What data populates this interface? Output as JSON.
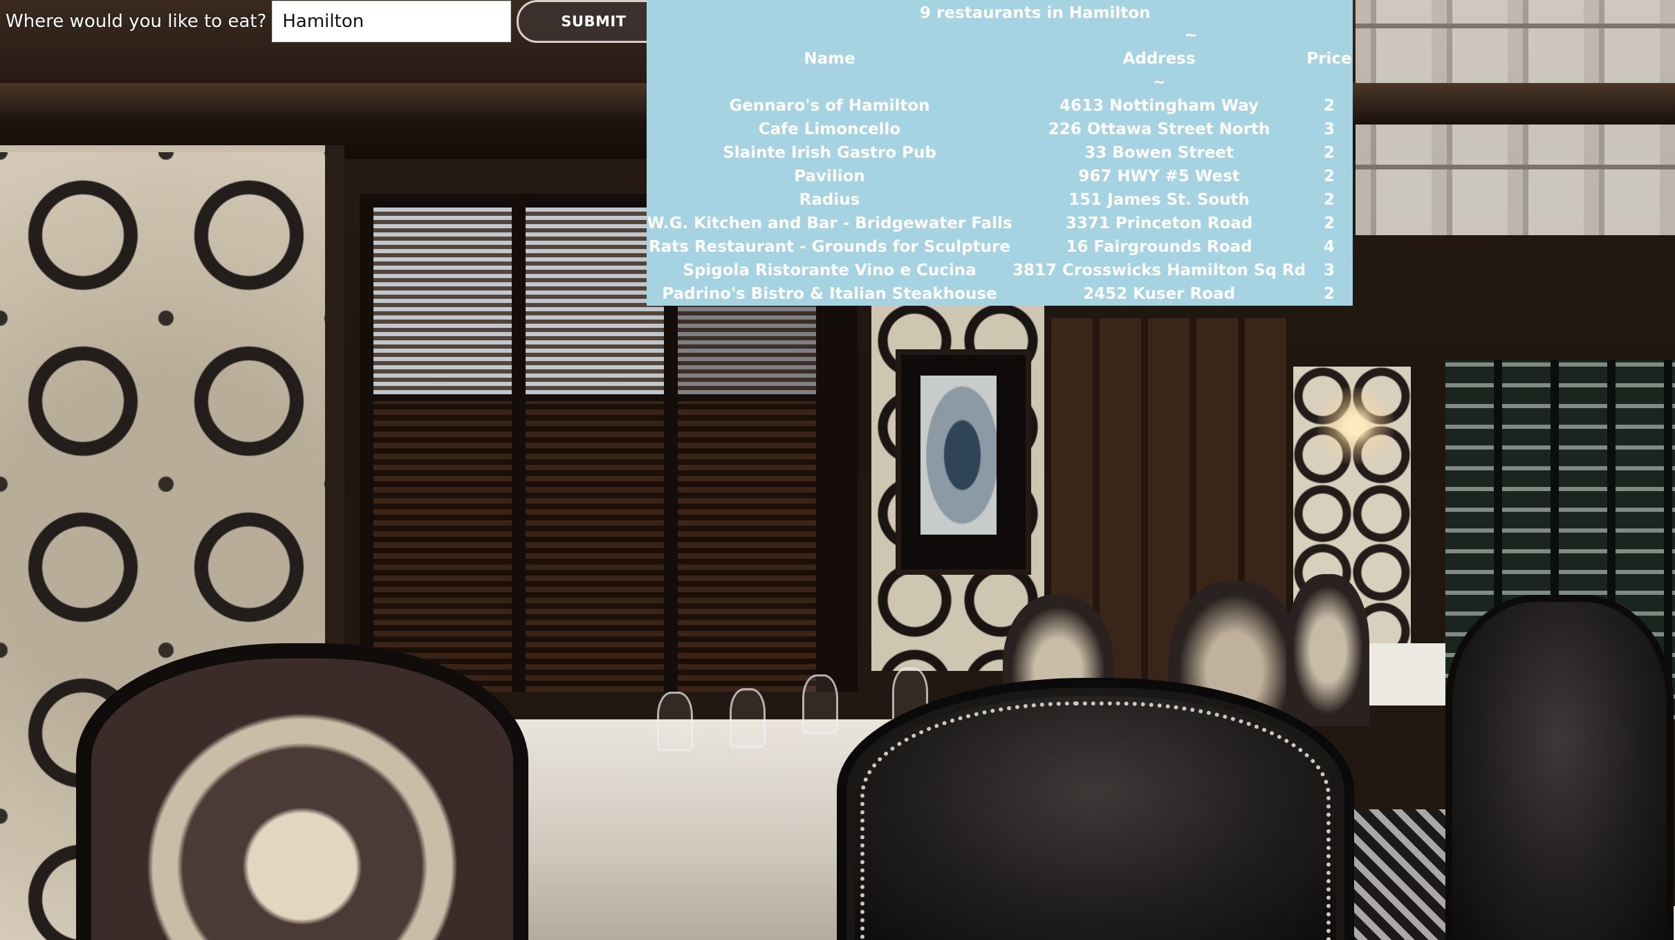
{
  "search": {
    "label": "Where would you like to eat?",
    "value": "Hamilton",
    "placeholder": "",
    "submit_label": "SUBMIT"
  },
  "results": {
    "count": "9",
    "summary_suffix": "restaurants in Hamilton",
    "divider": "~",
    "columns": {
      "name": "Name",
      "address": "Address",
      "price": "Price"
    },
    "rows": [
      {
        "name": "Gennaro's of Hamilton",
        "address": "4613 Nottingham Way",
        "price": "2"
      },
      {
        "name": "Cafe Limoncello",
        "address": "226 Ottawa Street North",
        "price": "3"
      },
      {
        "name": "Slainte Irish Gastro Pub",
        "address": "33 Bowen Street",
        "price": "2"
      },
      {
        "name": "Pavilion",
        "address": "967 HWY #5 West",
        "price": "2"
      },
      {
        "name": "Radius",
        "address": "151 James St. South",
        "price": "2"
      },
      {
        "name": "W.G. Kitchen and Bar - Bridgewater Falls",
        "address": "3371 Princeton Road",
        "price": "2"
      },
      {
        "name": "Rats Restaurant - Grounds for Sculpture",
        "address": "16 Fairgrounds Road",
        "price": "4"
      },
      {
        "name": "Spigola Ristorante Vino e Cucina",
        "address": "3817 Crosswicks Hamilton Sq Rd",
        "price": "3"
      },
      {
        "name": "Padrino's Bistro & Italian Steakhouse",
        "address": "2452 Kuser Road",
        "price": "2"
      }
    ],
    "colors": {
      "panel_bg": "#a6d3e2",
      "text": "#ffffff"
    }
  },
  "colors": {
    "submit_bg": "#3b302b",
    "submit_border": "#d9d1c8"
  }
}
